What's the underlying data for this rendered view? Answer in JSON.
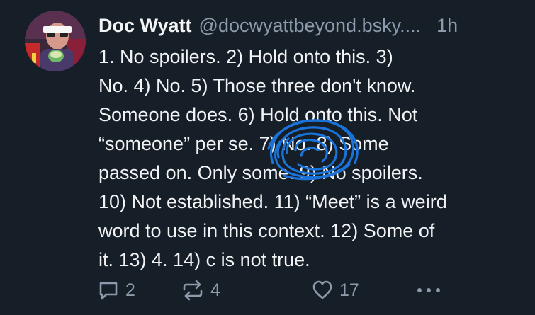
{
  "author": {
    "display_name": "Doc Wyatt",
    "handle": "@docwyattbeyond.bsky....",
    "avatar_icon": "avatar-photo"
  },
  "timestamp": "1h",
  "body_lines": [
    "1. No spoilers. 2) Hold onto this. 3)",
    "No. 4) No. 5) Those three don't know.",
    "Someone does. 6) Hold onto this. Not",
    "“someone” per se. 7) No. 8) Some",
    "passed on. Only some. 9) No spoilers.",
    "10) Not established. 11) “Meet” is a weird",
    "word to use in this context. 12) Some of",
    "it. 13) 4. 14) c is not true."
  ],
  "actions": {
    "reply_count": "2",
    "repost_count": "4",
    "like_count": "17",
    "reply_icon": "reply-bubble-icon",
    "repost_icon": "repost-arrows-icon",
    "like_icon": "heart-outline-icon",
    "more_icon": "ellipsis-icon"
  },
  "colors": {
    "background": "#161e27",
    "text": "#f1f3f5",
    "muted": "#8c9aab",
    "scribble": "#1a73d9"
  }
}
